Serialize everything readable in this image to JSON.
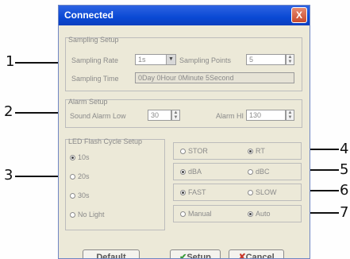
{
  "window": {
    "title": "Connected",
    "close_glyph": "X"
  },
  "sampling": {
    "group_label": "Sampling Setup",
    "rate_label": "Sampling Rate",
    "rate_value": "1s",
    "points_label": "Sampling Points",
    "points_value": "5",
    "time_label": "Sampling Time",
    "time_value": "0Day 0Hour 0Minute 5Second"
  },
  "alarm": {
    "group_label": "Alarm Setup",
    "low_label": "Sound Alarm Low",
    "low_value": "30",
    "high_label": "Alarm HI",
    "high_value": "130"
  },
  "led": {
    "group_label": "LED Flash Cycle Setup",
    "options": [
      "10s",
      "20s",
      "30s",
      "No Light"
    ],
    "selected": "10s"
  },
  "options": {
    "row1": {
      "a": "STOR",
      "b": "RT",
      "selected": "RT"
    },
    "row2": {
      "a": "dBA",
      "b": "dBC",
      "selected": "dBA"
    },
    "row3": {
      "a": "FAST",
      "b": "SLOW",
      "selected": "FAST"
    },
    "row4": {
      "a": "Manual",
      "b": "Auto",
      "selected": "Auto"
    }
  },
  "buttons": {
    "default": "Default",
    "setup": "Setup",
    "cancel": "Cancel",
    "cancel_icon": "✘",
    "setup_icon": "✔"
  },
  "callouts": [
    "1",
    "2",
    "3",
    "4",
    "5",
    "6",
    "7"
  ],
  "colors": {
    "titlebar": "#0a49d4",
    "dialog_bg": "#ece9d8",
    "close": "#d9603f",
    "callout": "#111111"
  }
}
